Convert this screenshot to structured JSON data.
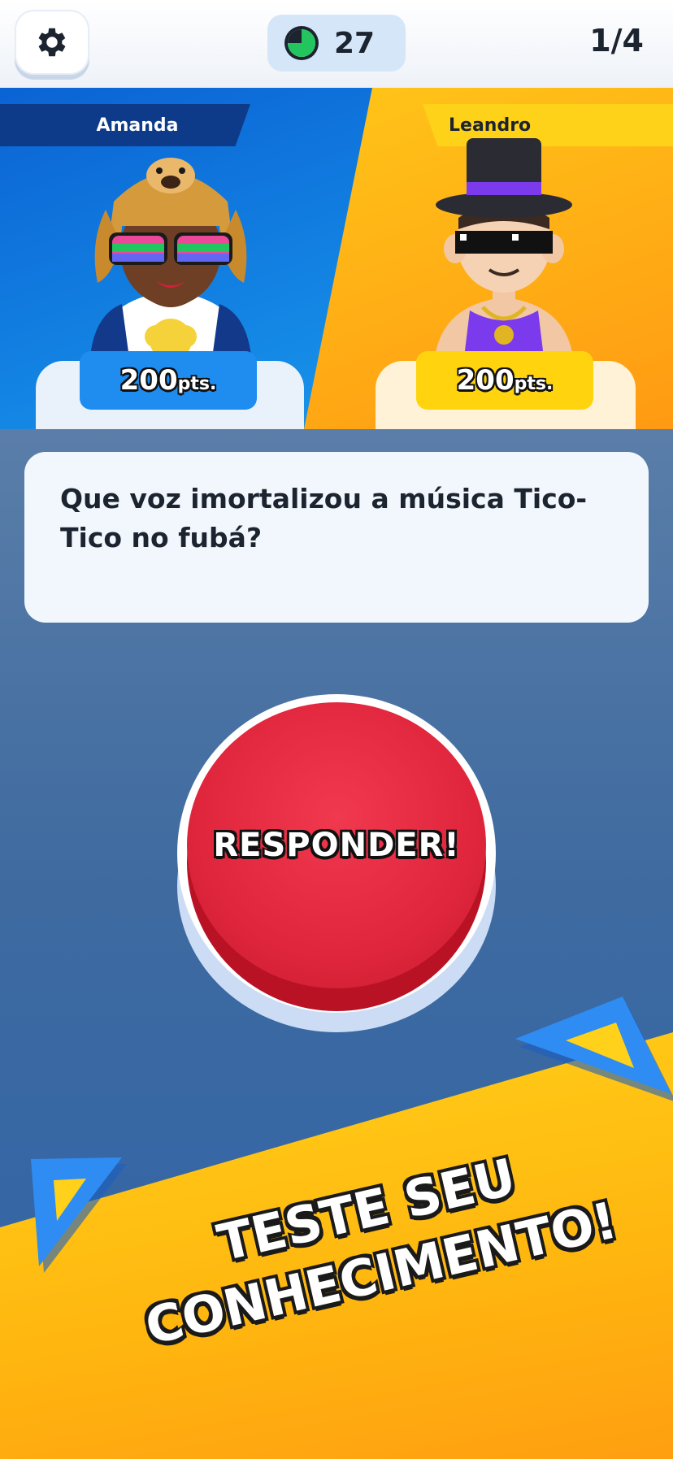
{
  "header": {
    "settings_icon": "gear-icon",
    "timer_icon": "pie-timer-icon",
    "timer_value": "27",
    "round": "1/4"
  },
  "players": [
    {
      "name": "Amanda",
      "score": "200",
      "unit": "pts.",
      "color": "#1f8cf0"
    },
    {
      "name": "Leandro",
      "score": "200",
      "unit": "pts.",
      "color": "#ffd40f"
    }
  ],
  "question": {
    "text": "Que voz imortalizou a música Tico-Tico no fubá?"
  },
  "answer_button": {
    "label": "RESPONDER!"
  },
  "promo": {
    "line1": "TESTE SEU",
    "line2": "CONHECIMENTO!"
  },
  "colors": {
    "accent_blue": "#1f8cf0",
    "accent_yellow": "#ffd11a",
    "button_red": "#e0263c"
  }
}
